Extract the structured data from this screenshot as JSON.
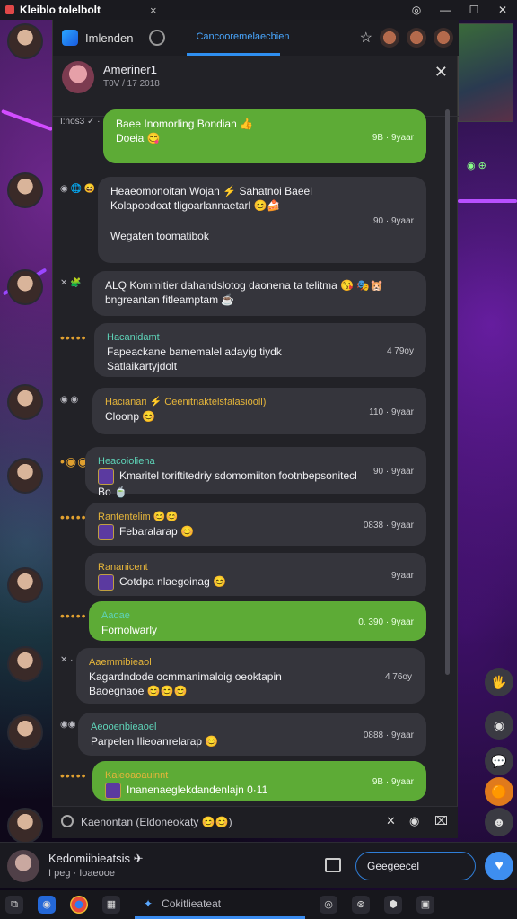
{
  "window": {
    "title": "Kleiblo tolelbolt",
    "close_tab": "×",
    "controls": [
      "◎",
      "—",
      "☐",
      "✕"
    ]
  },
  "nav": {
    "app_label": "Imlenden",
    "active_tab": "Cancooremelaecbien",
    "star_icon": "☆"
  },
  "chat_header": {
    "name": "Ameriner1",
    "subtitle": "T0V / 17 2018",
    "close": "✕"
  },
  "messages": [
    {
      "meta": "I:nos3 ✓ ·",
      "line1": "Baee Inomorling Bondian 👍",
      "line2": "Doeia 😋",
      "time": "9B · 9yaar",
      "style": "green"
    },
    {
      "meta": "◉ 🌐 😄",
      "line1": "Heaeomonoitan Wojan ⚡ Sahatnoi Baeel",
      "line2": "Kolapoodoat tligoarlannaetarl 😊🍰",
      "line3": "Wegaten toomatibok",
      "time": "90 · 9yaar",
      "style": "dark"
    },
    {
      "meta": "✕ 🧩",
      "line1": "ALQ Kommitier dahandslotog daonena ta telitma 😘 🎭🐹",
      "line2": "bngreantan fitleamptam ☕",
      "time": "",
      "style": "dark"
    },
    {
      "meta": "•••••",
      "sender": "Hacanidamt",
      "line1": "Fapeackane bamemalel adayig tiydk",
      "line2": "Satlaikartyjdolt",
      "time": "4 79oy",
      "style": "dark"
    },
    {
      "meta": "◉ ◉",
      "sender": "Hacianari ⚡ Ceenitnaktelsfalasiooll)",
      "line1": "Cloonp 😊",
      "time": "110 · 9yaar",
      "style": "dark"
    },
    {
      "meta": "•◉◉",
      "sender": "Heacoioliena",
      "line1": "Kmaritel toriftitedriy sdomomiiton footnbepsonitecl",
      "line2": "Bo 🍵",
      "time": "90 · 9yaar",
      "style": "dark",
      "thumb": true
    },
    {
      "meta": "•••••",
      "sender": "Rantentelim 😊😊",
      "line1": "Febaralarap 😊",
      "time": "0838 · 9yaar",
      "style": "dark",
      "thumb": true
    },
    {
      "meta": "",
      "sender": "Rananicent",
      "line1": "Cotdpa nlaegoinag 😊",
      "time": "9yaar",
      "style": "dark",
      "thumb": true
    },
    {
      "meta": "•••••",
      "sender": "Aaoae",
      "line1": "Fornolwarly",
      "time": "0. 390 · 9yaar",
      "style": "green"
    },
    {
      "meta": "✕ ·",
      "sender": "Aaemmibieaol",
      "line1": "Kagardndode ocmmanimaloig oeoktapin",
      "line2": "Baoegnaoe 😊😊😊",
      "time": "4 76oy",
      "style": "dark"
    },
    {
      "meta": "◉◉",
      "sender": "Aeooenbieaoel",
      "line1": "Parpelen Ilieoanrelarap 😊",
      "time": "0888 · 9yaar",
      "style": "dark"
    },
    {
      "meta": "•••••",
      "sender": "Kaieoaoauinnt",
      "line1": "Inanenaeglekdandenlajn 0·11",
      "time": "9B · 9yaar",
      "style": "green",
      "thumb": true
    }
  ],
  "composer": {
    "text": "Kaenontan (Eldoneokaty 😊😊)",
    "icon_x": "✕",
    "icon_clip": "◉",
    "icon_attach": "⌧"
  },
  "user": {
    "name": "Kedomiibieatsis ✈",
    "status": "I peg · Ioaeooe",
    "button": "Geegeecel",
    "heart": "♥"
  },
  "fabs": [
    "🖐",
    "◉",
    "💬",
    "🟠",
    "☻"
  ],
  "side": {
    "badge": "◉ ⊕"
  },
  "taskbar": {
    "active_label": "Cokitlieateat",
    "items": [
      "⧉",
      "◉",
      "C",
      "▦",
      "✦",
      "◎",
      "⊛",
      "⬢",
      "▣",
      "▤",
      "⊞",
      "▤"
    ]
  }
}
